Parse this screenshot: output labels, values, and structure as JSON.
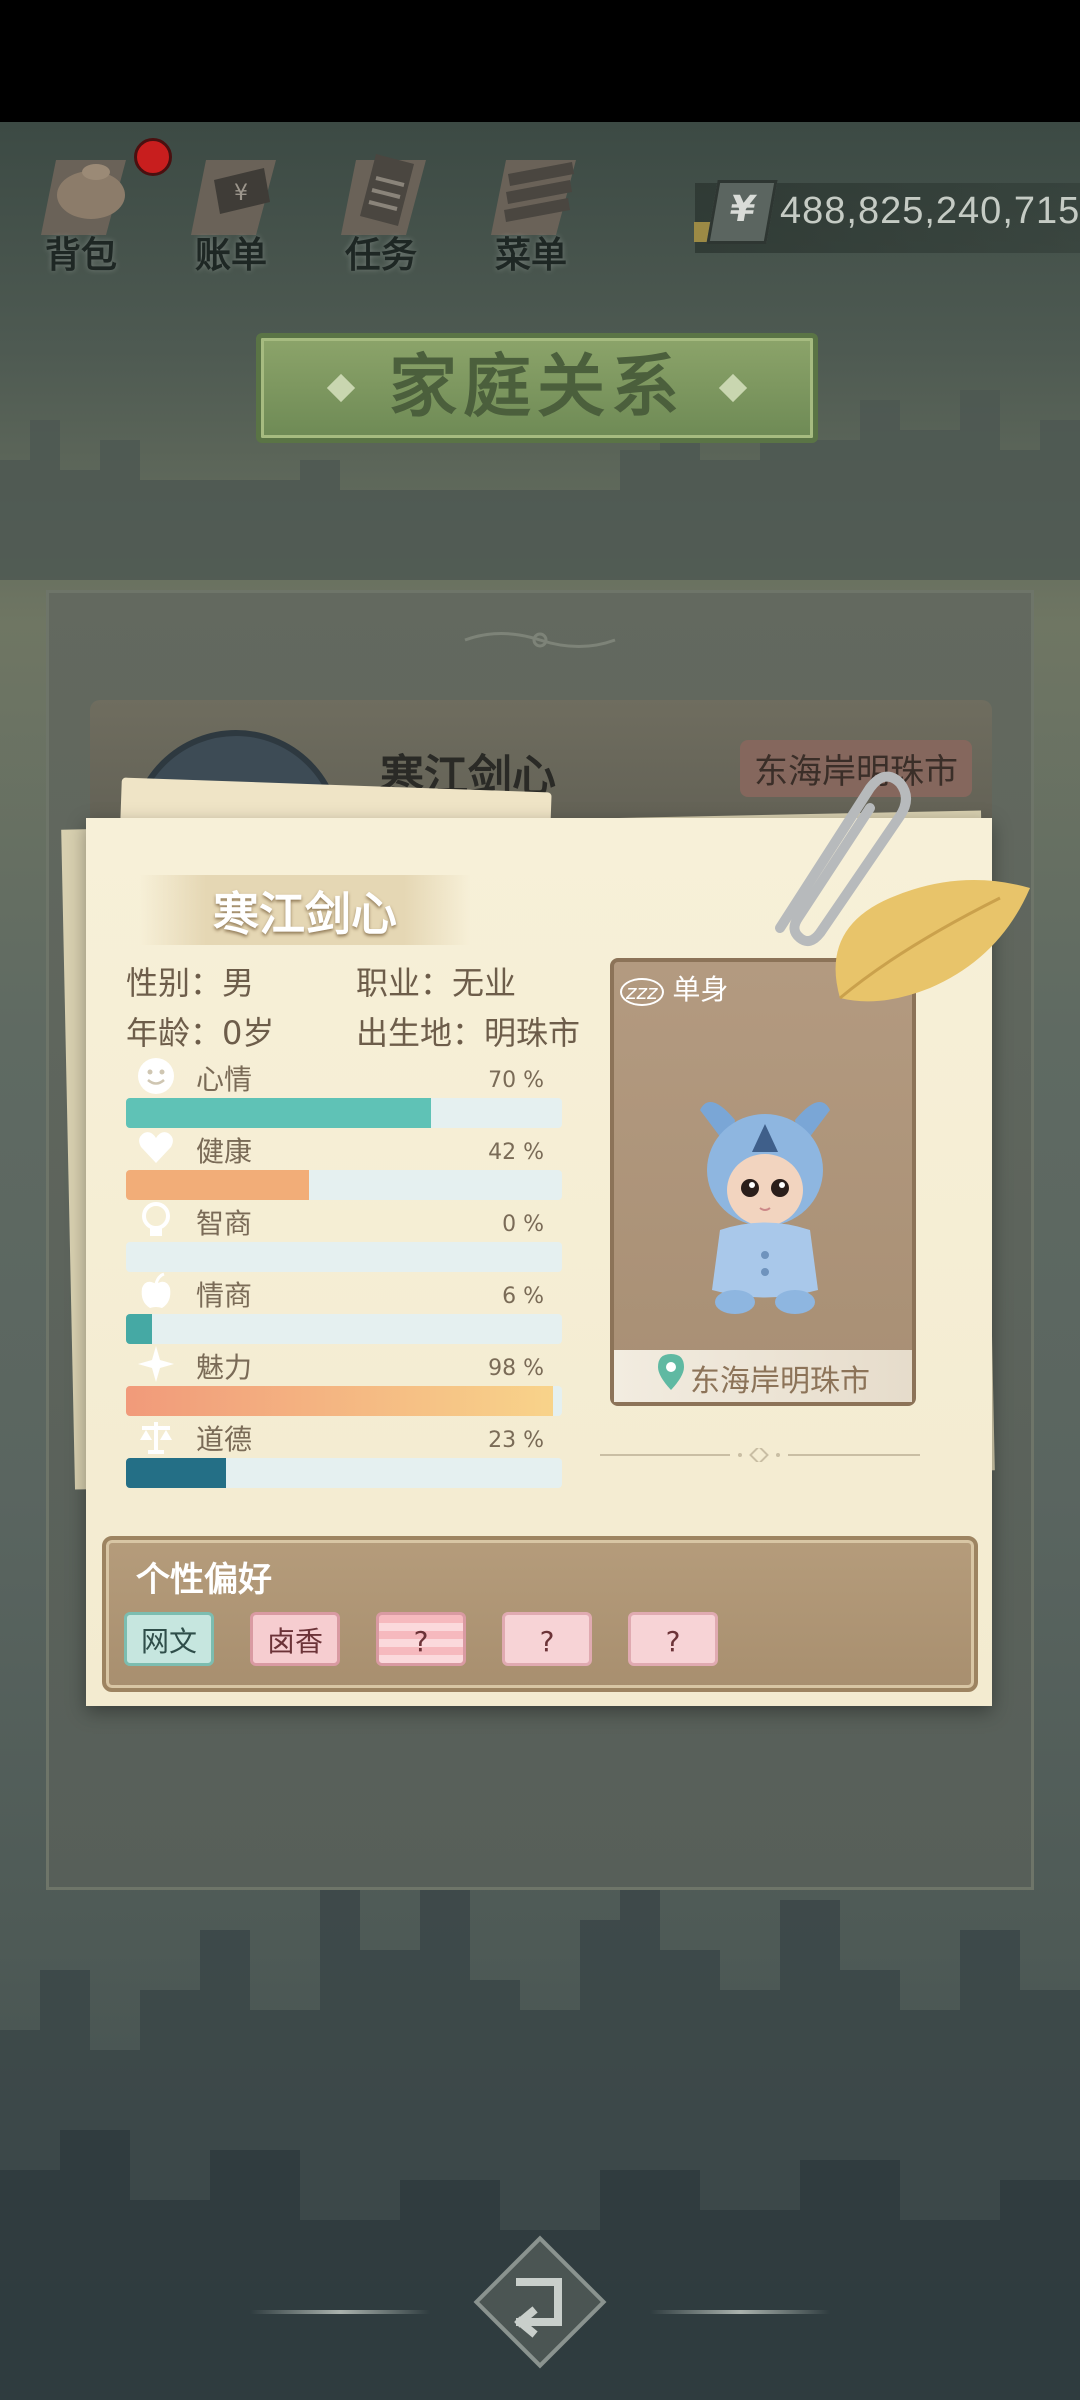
{
  "nav": {
    "items": [
      {
        "label": "背包",
        "icon": "bag-icon"
      },
      {
        "label": "账单",
        "icon": "bill-icon"
      },
      {
        "label": "任务",
        "icon": "task-icon"
      },
      {
        "label": "菜单",
        "icon": "menu-icon"
      }
    ],
    "currency_symbol": "¥",
    "money": "488,825,240,715"
  },
  "title": "家庭关系",
  "card_behind": {
    "name": "寒江剑心",
    "location": "东海岸明珠市"
  },
  "character": {
    "name": "寒江剑心",
    "gender_label": "性别：男",
    "job_label": "职业：无业",
    "age_label": "年龄：0岁",
    "birthplace_label": "出生地：明珠市",
    "status_icon": "zzz",
    "status": "单身",
    "location": "东海岸明珠市"
  },
  "stats": [
    {
      "label": "心情",
      "pct_text": "70 %",
      "value": 0.7,
      "icon": "smile-icon",
      "color": "#5fc2b6"
    },
    {
      "label": "健康",
      "pct_text": "42 %",
      "value": 0.42,
      "icon": "heart-icon",
      "color": "#f2ad78"
    },
    {
      "label": "智商",
      "pct_text": "0 %",
      "value": 0.0,
      "icon": "bulb-icon",
      "color": "#7aa4b0"
    },
    {
      "label": "情商",
      "pct_text": "6 %",
      "value": 0.06,
      "icon": "apple-icon",
      "color": "#45a9a4"
    },
    {
      "label": "魅力",
      "pct_text": "98 %",
      "value": 0.98,
      "icon": "sparkle-icon",
      "color": "#f5b070"
    },
    {
      "label": "道德",
      "pct_text": "23 %",
      "value": 0.23,
      "icon": "scales-icon",
      "color": "#246f86"
    }
  ],
  "preferences": {
    "title": "个性偏好",
    "tags": [
      "网文",
      "卤香",
      "?",
      "?",
      "?"
    ]
  }
}
